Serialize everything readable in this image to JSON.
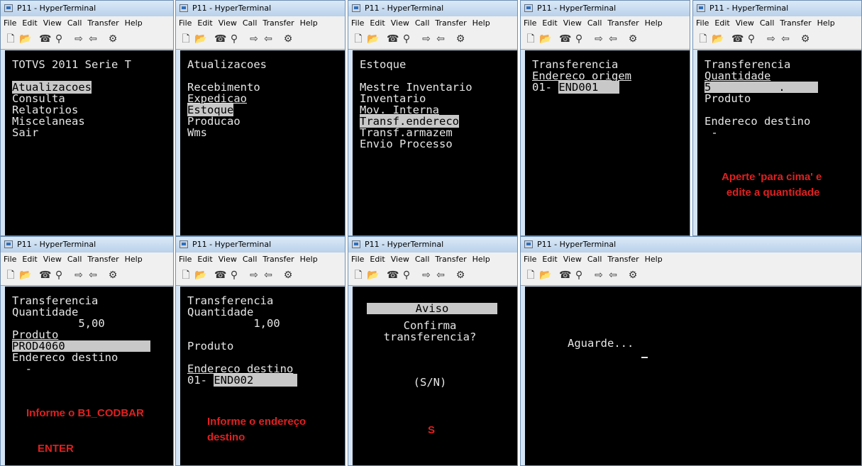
{
  "app": {
    "title": "P11 - HyperTerminal",
    "menu": [
      "File",
      "Edit",
      "View",
      "Call",
      "Transfer",
      "Help"
    ]
  },
  "toolbar_icons": [
    "new-icon",
    "open-icon",
    "disconnect-icon",
    "dial-icon",
    "send-icon",
    "receive-icon",
    "properties-icon"
  ],
  "screens": [
    {
      "lines": [
        "TOTVS 2011 Serie T",
        "",
        "Atualizacoes",
        "Consulta",
        "Relatorios",
        "Miscelaneas",
        "Sair"
      ],
      "selected": "Atualizacoes"
    },
    {
      "lines": [
        "Atualizacoes",
        "",
        "Recebimento",
        "Expedicao",
        "Estoque",
        "Producao",
        "Wms"
      ],
      "selected": "Estoque"
    },
    {
      "lines": [
        "Estoque",
        "",
        "Mestre Inventario",
        "Inventario",
        "Mov. Interna",
        "Transf.endereco",
        "Transf.armazem",
        "Envio Processo"
      ],
      "selected": "Transf.endereco"
    },
    {
      "lines": [
        "Transferencia",
        "Endereco origem",
        "01- "
      ],
      "field_value": "END001"
    },
    {
      "lines": [
        "Transferencia",
        "Quantidade",
        "",
        "Produto",
        "",
        "Endereco destino",
        " -"
      ],
      "field_value": "5",
      "field_dot": ".",
      "note": [
        "Aperte 'para cima' e",
        "edite a quantidade"
      ]
    },
    {
      "lines": [
        "Transferencia",
        "Quantidade",
        "          5,00",
        "Produto",
        "",
        "Endereco destino",
        "  -"
      ],
      "field_value": "PROD4060",
      "notes": [
        "Informe o B1_CODBAR",
        "ENTER"
      ]
    },
    {
      "lines": [
        "Transferencia",
        "Quantidade",
        "          1,00",
        "",
        "Produto",
        "",
        "Endereco destino",
        "01- "
      ],
      "field_value": "END002",
      "note": [
        "Informe o endereço",
        "destino"
      ]
    },
    {
      "header": "Aviso",
      "lines": [
        "Confirma",
        "transferencia?",
        "",
        "",
        "",
        "(S/N)"
      ],
      "note": "S"
    },
    {
      "lines": [
        "Aguarde..."
      ]
    }
  ],
  "colors": {
    "terminal_bg": "#000000",
    "terminal_fg": "#e6e6e6",
    "highlight": "#c8c8c8",
    "annotation": "#e02020"
  }
}
